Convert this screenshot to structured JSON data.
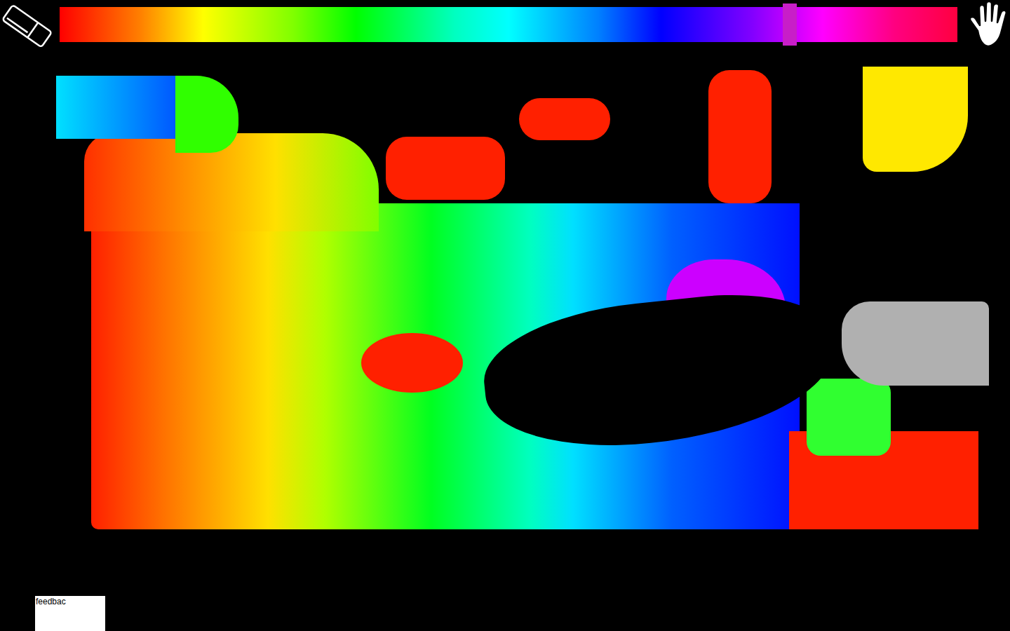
{
  "palette": {
    "level": 0.813
  },
  "feedback": {
    "label": "feedbac"
  }
}
